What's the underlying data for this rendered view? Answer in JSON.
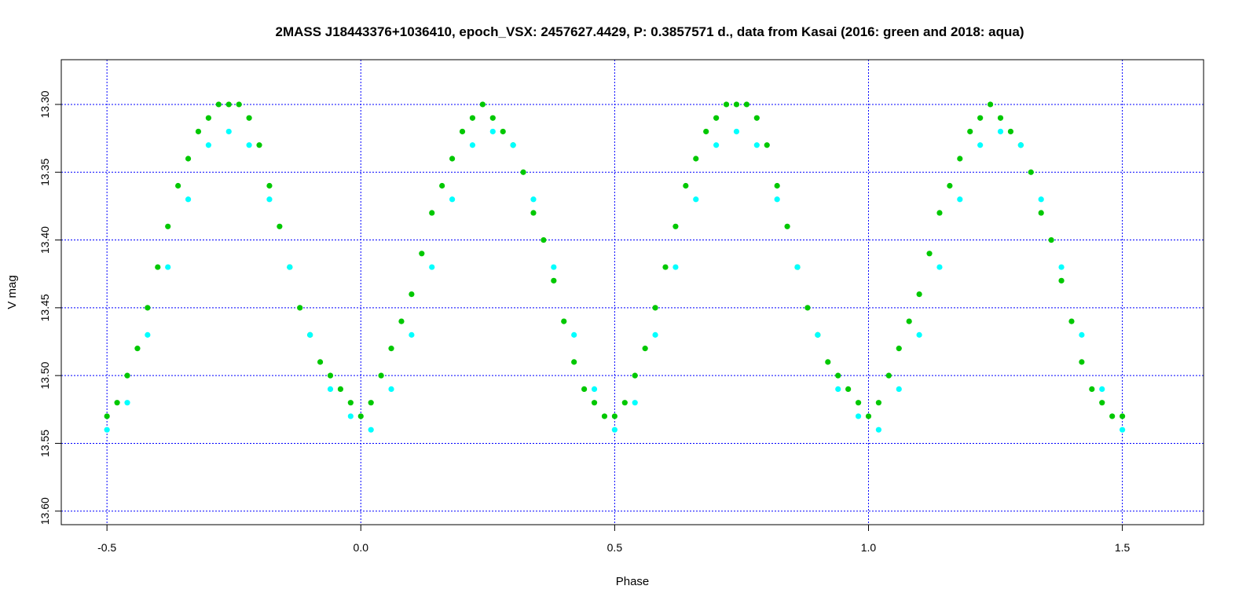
{
  "chart_data": {
    "type": "scatter",
    "title": "2MASS J18443376+1036410, epoch_VSX: 2457627.4429, P: 0.3857571 d., data from Kasai (2016: green and 2018: aqua)",
    "xlabel": "Phase",
    "ylabel": "V mag",
    "xlim": [
      -0.59,
      1.66
    ],
    "ylim": [
      13.61,
      13.267
    ],
    "y_inverted": true,
    "x_ticks": [
      -0.5,
      0.0,
      0.5,
      1.0,
      1.5
    ],
    "x_tick_labels": [
      "-0.5",
      "0.0",
      "0.5",
      "1.0",
      "1.5"
    ],
    "y_ticks": [
      13.3,
      13.35,
      13.4,
      13.45,
      13.5,
      13.55,
      13.6
    ],
    "y_tick_labels": [
      "13.30",
      "13.35",
      "13.40",
      "13.45",
      "13.50",
      "13.55",
      "13.60"
    ],
    "grid": true,
    "grid_color": "#0000ff",
    "colors": {
      "2016": "#00c800",
      "2018": "#00ffff"
    },
    "series": [
      {
        "color": "#00c800",
        "x": [
          -0.5,
          -0.48,
          -0.46,
          -0.44,
          -0.42,
          -0.4,
          -0.38,
          -0.36,
          -0.34,
          -0.32,
          -0.3,
          -0.28,
          -0.26,
          -0.24,
          -0.22,
          -0.2,
          -0.18,
          -0.16,
          -0.14,
          -0.12,
          -0.1,
          -0.08,
          -0.06,
          -0.04,
          -0.02,
          0.0,
          0.02,
          0.04,
          0.06,
          0.08,
          0.1,
          0.12,
          0.14,
          0.16,
          0.18,
          0.2,
          0.22,
          0.24,
          0.26,
          0.28,
          0.3,
          0.32,
          0.34,
          0.36,
          0.38,
          0.4,
          0.42,
          0.44,
          0.46,
          0.48,
          0.5,
          0.52,
          0.54,
          0.56,
          0.58,
          0.6,
          0.62,
          0.64,
          0.66,
          0.68,
          0.7,
          0.72,
          0.74,
          0.76,
          0.78,
          0.8,
          0.82,
          0.84,
          0.86,
          0.88,
          0.9,
          0.92,
          0.94,
          0.96,
          0.98,
          1.0,
          1.02,
          1.04,
          1.06,
          1.08,
          1.1,
          1.12,
          1.14,
          1.16,
          1.18,
          1.2,
          1.22,
          1.24,
          1.26,
          1.28,
          1.3,
          1.32,
          1.34,
          1.36,
          1.38,
          1.4,
          1.42,
          1.44,
          1.46,
          1.48,
          1.5
        ],
        "y": [
          13.53,
          13.52,
          13.5,
          13.48,
          13.45,
          13.42,
          13.39,
          13.36,
          13.34,
          13.32,
          13.31,
          13.3,
          13.3,
          13.3,
          13.31,
          13.33,
          13.36,
          13.39,
          13.42,
          13.45,
          13.47,
          13.49,
          13.5,
          13.51,
          13.52,
          13.53,
          13.52,
          13.5,
          13.48,
          13.46,
          13.44,
          13.41,
          13.38,
          13.36,
          13.34,
          13.32,
          13.31,
          13.3,
          13.31,
          13.32,
          13.33,
          13.35,
          13.38,
          13.4,
          13.43,
          13.46,
          13.49,
          13.51,
          13.52,
          13.53,
          13.53,
          13.52,
          13.5,
          13.48,
          13.45,
          13.42,
          13.39,
          13.36,
          13.34,
          13.32,
          13.31,
          13.3,
          13.3,
          13.3,
          13.31,
          13.33,
          13.36,
          13.39,
          13.42,
          13.45,
          13.47,
          13.49,
          13.5,
          13.51,
          13.52,
          13.53,
          13.52,
          13.5,
          13.48,
          13.46,
          13.44,
          13.41,
          13.38,
          13.36,
          13.34,
          13.32,
          13.31,
          13.3,
          13.31,
          13.32,
          13.33,
          13.35,
          13.38,
          13.4,
          13.43,
          13.46,
          13.49,
          13.51,
          13.52,
          13.53,
          13.53
        ]
      },
      {
        "color": "#00ffff",
        "x": [
          -0.5,
          -0.46,
          -0.42,
          -0.38,
          -0.34,
          -0.3,
          -0.26,
          -0.22,
          -0.18,
          -0.14,
          -0.1,
          -0.06,
          -0.02,
          0.02,
          0.06,
          0.1,
          0.14,
          0.18,
          0.22,
          0.26,
          0.3,
          0.34,
          0.38,
          0.42,
          0.46,
          0.5,
          0.54,
          0.58,
          0.62,
          0.66,
          0.7,
          0.74,
          0.78,
          0.82,
          0.86,
          0.9,
          0.94,
          0.98,
          1.02,
          1.06,
          1.1,
          1.14,
          1.18,
          1.22,
          1.26,
          1.3,
          1.34,
          1.38,
          1.42,
          1.46,
          1.5
        ],
        "y": [
          13.54,
          13.52,
          13.47,
          13.42,
          13.37,
          13.33,
          13.32,
          13.33,
          13.37,
          13.42,
          13.47,
          13.51,
          13.53,
          13.54,
          13.51,
          13.47,
          13.42,
          13.37,
          13.33,
          13.32,
          13.33,
          13.37,
          13.42,
          13.47,
          13.51,
          13.54,
          13.52,
          13.47,
          13.42,
          13.37,
          13.33,
          13.32,
          13.33,
          13.37,
          13.42,
          13.47,
          13.51,
          13.53,
          13.54,
          13.51,
          13.47,
          13.42,
          13.37,
          13.33,
          13.32,
          13.33,
          13.37,
          13.42,
          13.47,
          13.51,
          13.54
        ]
      }
    ]
  }
}
